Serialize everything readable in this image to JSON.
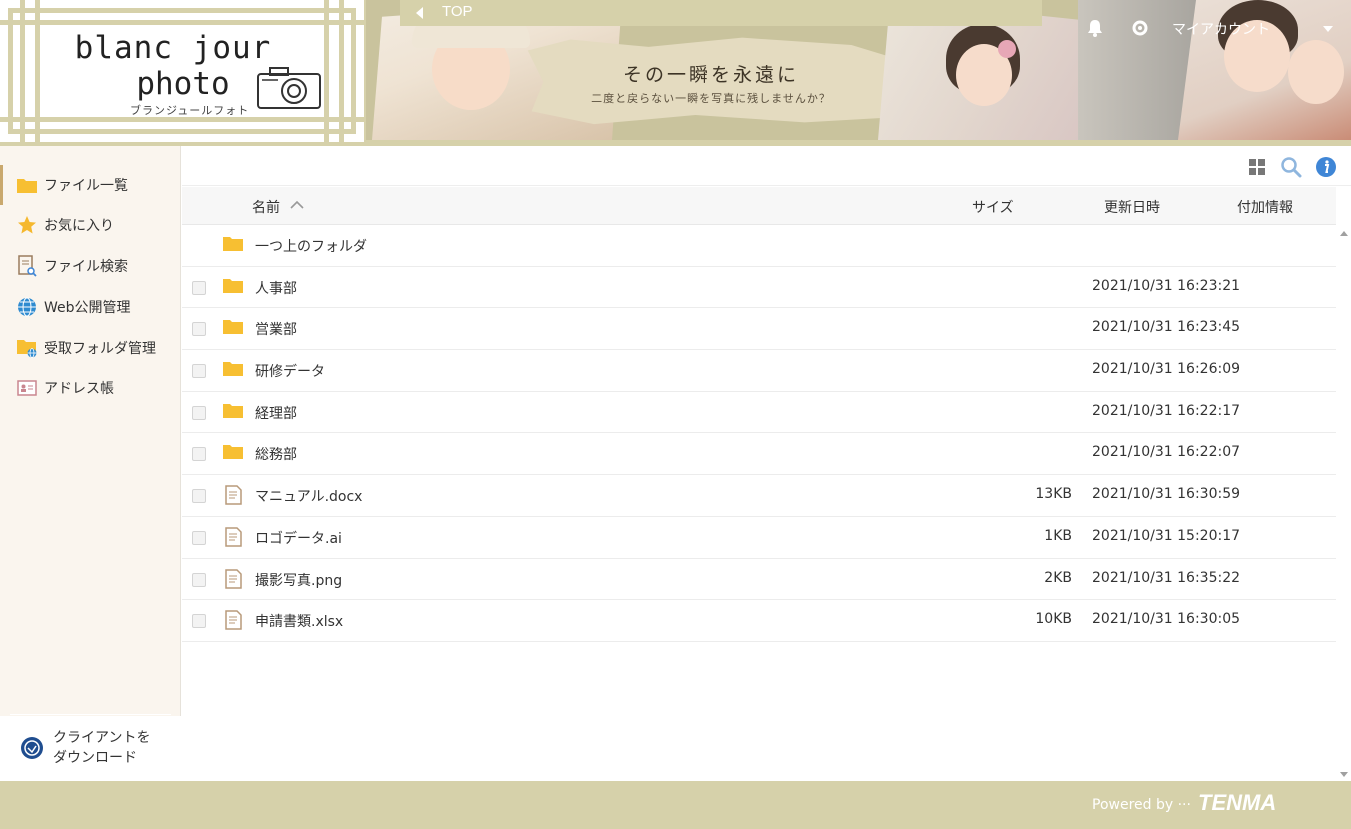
{
  "app": {
    "logo_line1": "blanc jour",
    "logo_line2": "photo",
    "logo_kana": "ブランジュールフォト"
  },
  "banner": {
    "top_tab": "TOP",
    "tagline_main": "その一瞬を永遠に",
    "tagline_sub": "二度と戻らない一瞬を写真に残しませんか？",
    "account_label": "マイアカウント"
  },
  "sidebar": {
    "items": [
      {
        "label": "ファイル一覧",
        "icon": "folder-icon",
        "active": true
      },
      {
        "label": "お気に入り",
        "icon": "star-icon"
      },
      {
        "label": "ファイル検索",
        "icon": "file-search-icon"
      },
      {
        "label": "Web公開管理",
        "icon": "globe-icon"
      },
      {
        "label": "受取フォルダ管理",
        "icon": "receive-folder-icon"
      },
      {
        "label": "アドレス帳",
        "icon": "address-book-icon"
      }
    ],
    "download_label_1": "クライアントを",
    "download_label_2": "ダウンロード"
  },
  "table": {
    "columns": {
      "name": "名前",
      "size": "サイズ",
      "date": "更新日時",
      "extra": "付加情報"
    },
    "parent_folder": "一つ上のフォルダ",
    "rows": [
      {
        "type": "folder",
        "name": "人事部",
        "size": "",
        "date": "2021/10/31 16:23:21"
      },
      {
        "type": "folder",
        "name": "営業部",
        "size": "",
        "date": "2021/10/31 16:23:45"
      },
      {
        "type": "folder",
        "name": "研修データ",
        "size": "",
        "date": "2021/10/31 16:26:09"
      },
      {
        "type": "folder",
        "name": "経理部",
        "size": "",
        "date": "2021/10/31 16:22:17"
      },
      {
        "type": "folder",
        "name": "総務部",
        "size": "",
        "date": "2021/10/31 16:22:07"
      },
      {
        "type": "file",
        "name": "マニュアル.docx",
        "size": "13KB",
        "date": "2021/10/31 16:30:59"
      },
      {
        "type": "file",
        "name": "ロゴデータ.ai",
        "size": "1KB",
        "date": "2021/10/31 15:20:17"
      },
      {
        "type": "file",
        "name": "撮影写真.png",
        "size": "2KB",
        "date": "2021/10/31 16:35:22"
      },
      {
        "type": "file",
        "name": "申請書類.xlsx",
        "size": "10KB",
        "date": "2021/10/31 16:30:05"
      }
    ]
  },
  "footer": {
    "powered_by": "Powered by ···",
    "brand": "TENMA"
  },
  "colors": {
    "accent": "#d6d1aa",
    "folder": "#f7bf32",
    "sidebar_bg": "#faf5ee",
    "info_blue": "#3f86d6"
  }
}
